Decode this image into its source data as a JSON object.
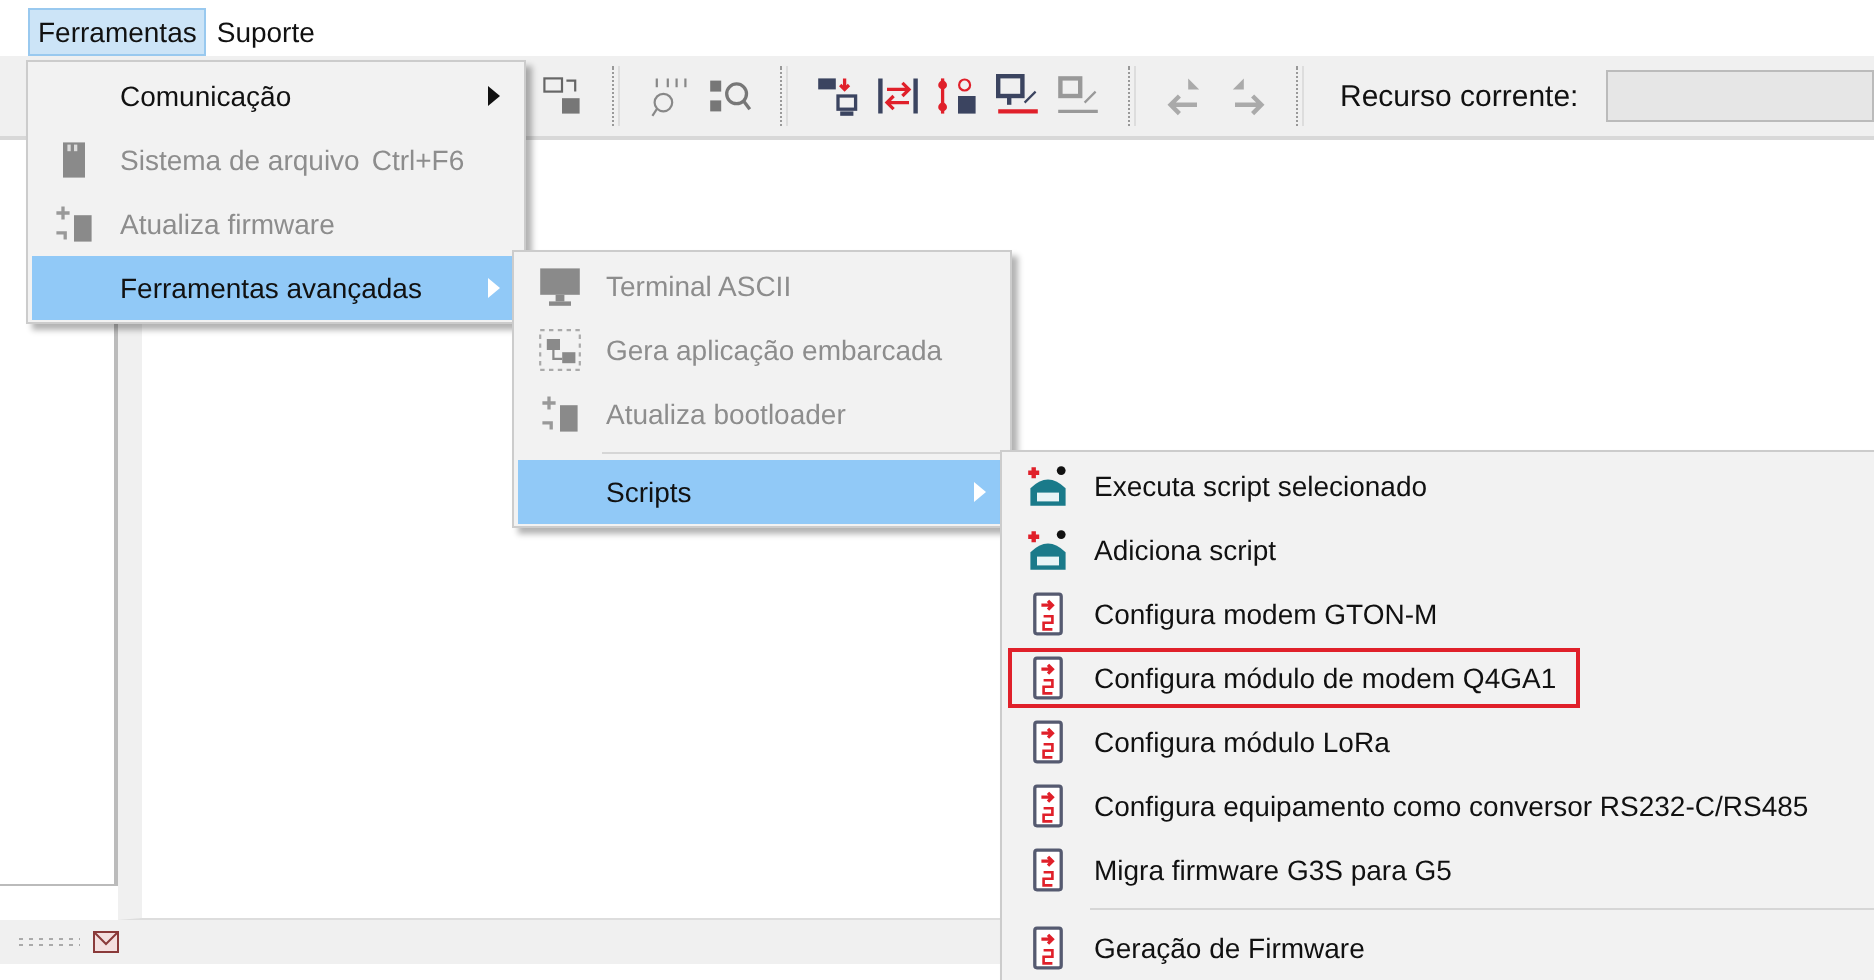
{
  "menubar": [
    {
      "label": "Ferramentas",
      "selected": true
    },
    {
      "label": "Suporte",
      "selected": false
    }
  ],
  "toolbar": {
    "resource_label": "Recurso corrente:"
  },
  "menus": [
    {
      "items": [
        {
          "label": "Comunicação",
          "kind": "plain",
          "disabled": false,
          "selected": false,
          "submenu": true,
          "separator_before": false,
          "outlined": false
        },
        {
          "label": "Sistema de arquivo",
          "shortcut": "Ctrl+F6",
          "kind": "sdcard",
          "disabled": true,
          "selected": false,
          "submenu": false,
          "separator_before": false,
          "outlined": false
        },
        {
          "label": "Atualiza firmware",
          "kind": "firmware",
          "disabled": true,
          "selected": false,
          "submenu": false,
          "separator_before": false,
          "outlined": false
        },
        {
          "label": "Ferramentas avançadas",
          "kind": "plain",
          "disabled": false,
          "selected": true,
          "submenu": true,
          "separator_before": false,
          "outlined": false
        }
      ]
    },
    {
      "items": [
        {
          "label": "Terminal ASCII",
          "kind": "terminal",
          "disabled": true,
          "selected": false,
          "submenu": false,
          "separator_before": false,
          "outlined": false
        },
        {
          "label": "Gera aplicação embarcada",
          "kind": "embedded",
          "disabled": true,
          "selected": false,
          "submenu": false,
          "separator_before": false,
          "outlined": false
        },
        {
          "label": "Atualiza bootloader",
          "kind": "firmware",
          "disabled": true,
          "selected": false,
          "submenu": false,
          "separator_before": false,
          "outlined": false
        },
        {
          "label": "Scripts",
          "kind": "plain",
          "disabled": false,
          "selected": true,
          "submenu": true,
          "separator_before": true,
          "outlined": false
        }
      ]
    },
    {
      "items": [
        {
          "label": "Executa script selecionado",
          "kind": "lua",
          "disabled": false,
          "selected": false,
          "submenu": false,
          "separator_before": false,
          "outlined": false
        },
        {
          "label": "Adiciona script",
          "kind": "lua",
          "disabled": false,
          "selected": false,
          "submenu": false,
          "separator_before": false,
          "outlined": false
        },
        {
          "label": "Configura modem GTON-M",
          "kind": "script",
          "disabled": false,
          "selected": false,
          "submenu": false,
          "separator_before": false,
          "outlined": false
        },
        {
          "label": "Configura módulo de modem Q4GA1",
          "kind": "script",
          "disabled": false,
          "selected": false,
          "submenu": false,
          "separator_before": false,
          "outlined": true
        },
        {
          "label": "Configura módulo LoRa",
          "kind": "script",
          "disabled": false,
          "selected": false,
          "submenu": false,
          "separator_before": false,
          "outlined": false
        },
        {
          "label": "Configura equipamento como conversor RS232-C/RS485",
          "kind": "script",
          "disabled": false,
          "selected": false,
          "submenu": false,
          "separator_before": false,
          "outlined": false
        },
        {
          "label": "Migra firmware G3S para G5",
          "kind": "script",
          "disabled": false,
          "selected": false,
          "submenu": false,
          "separator_before": false,
          "outlined": false
        },
        {
          "label": "Geração de Firmware",
          "kind": "script",
          "disabled": false,
          "selected": false,
          "submenu": false,
          "separator_before": true,
          "outlined": false
        }
      ]
    }
  ]
}
